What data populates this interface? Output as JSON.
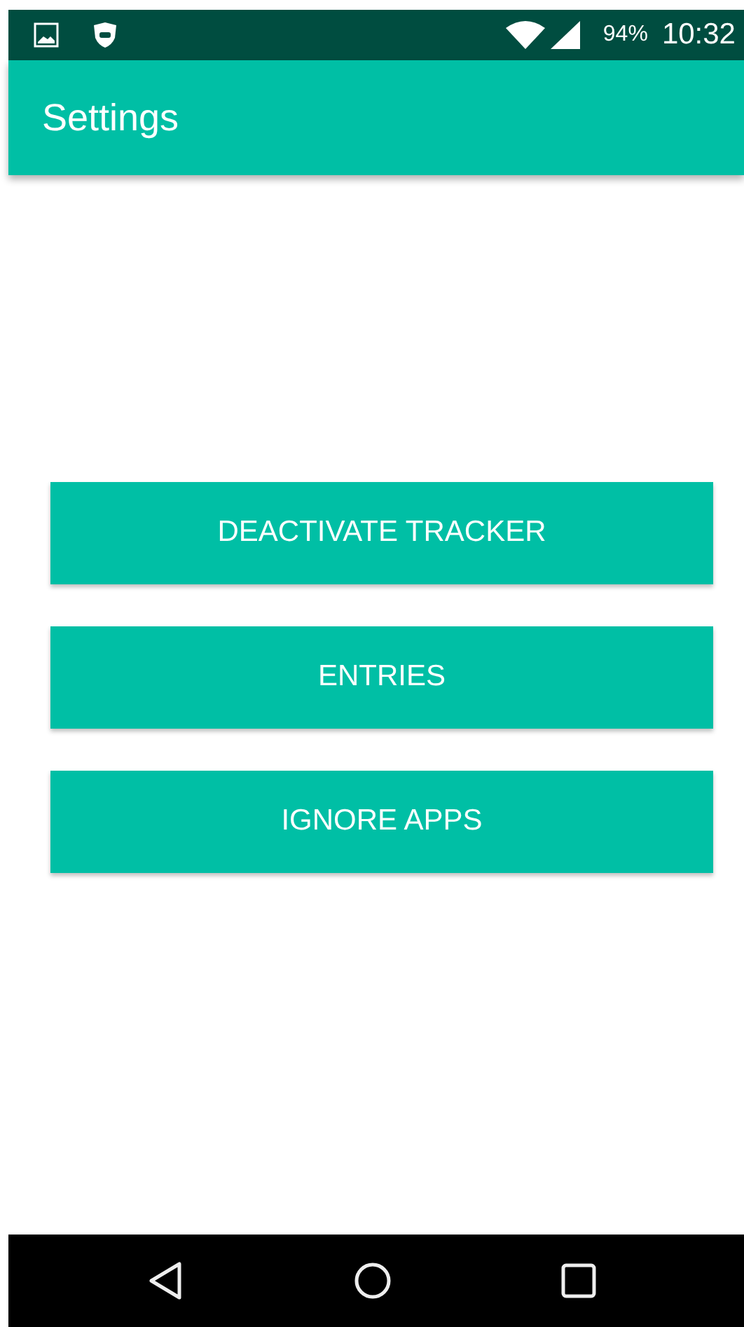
{
  "status_bar": {
    "battery": "94%",
    "time": "10:32"
  },
  "app_bar": {
    "title": "Settings"
  },
  "buttons": [
    {
      "label": "DEACTIVATE TRACKER"
    },
    {
      "label": "ENTRIES"
    },
    {
      "label": "IGNORE APPS"
    }
  ]
}
